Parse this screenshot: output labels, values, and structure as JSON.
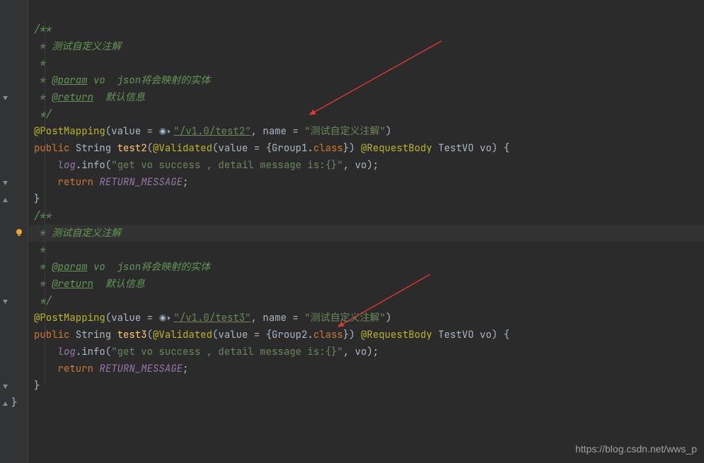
{
  "watermark": "https://blog.csdn.net/wws_p",
  "block1": {
    "c0": "/**",
    "c1": " * 测试自定义注解",
    "c2": " *",
    "c3": " * ",
    "c3tag": "@param",
    "c3rest": " vo  json将会映射的实体",
    "c4": " * ",
    "c4tag": "@return",
    "c4rest": "  默认信息",
    "c5": " */",
    "anno": "@PostMapping",
    "value_kw": "value = ",
    "url": "\"/v1.0/test2\"",
    "name_kw": ", name = ",
    "name_val": "\"测试自定义注解\"",
    "sig_public": "public",
    "sig_type": " String ",
    "sig_method": "test2",
    "sig_open": "(",
    "validated": "@Validated",
    "validated_arg": "(value = {Group1.",
    "class_kw": "class",
    "close_val": "}) ",
    "reqbody": "@RequestBody",
    "reqbody_after": " TestVO vo) {",
    "log": "log",
    "info": ".info(",
    "logstr": "\"get vo success , detail message is:{}\"",
    "logrest": ", vo);",
    "ret": "return ",
    "retval": "RETURN_MESSAGE",
    "semi": ";",
    "brace": "}"
  },
  "block2": {
    "c0": "/**",
    "c1": " * 测试自定义注解",
    "c2": " *",
    "c3": " * ",
    "c3tag": "@param",
    "c3rest": " vo  json将会映射的实体",
    "c4": " * ",
    "c4tag": "@return",
    "c4rest": "  默认信息",
    "c5": " */",
    "anno": "@PostMapping",
    "value_kw": "value = ",
    "url": "\"/v1.0/test3\"",
    "name_kw": ", name = ",
    "name_val": "\"测试自定义注解\"",
    "sig_public": "public",
    "sig_type": " String ",
    "sig_method": "test3",
    "sig_open": "(",
    "validated": "@Validated",
    "validated_arg": "(value = {Group2.",
    "class_kw": "class",
    "close_val": "}) ",
    "reqbody": "@RequestBody",
    "reqbody_after": " TestVO vo) {",
    "log": "log",
    "info": ".info(",
    "logstr": "\"get vo success , detail message is:{}\"",
    "logrest": ", vo);",
    "ret": "return ",
    "retval": "RETURN_MESSAGE",
    "semi": ";",
    "brace": "}"
  },
  "classClose": "}"
}
